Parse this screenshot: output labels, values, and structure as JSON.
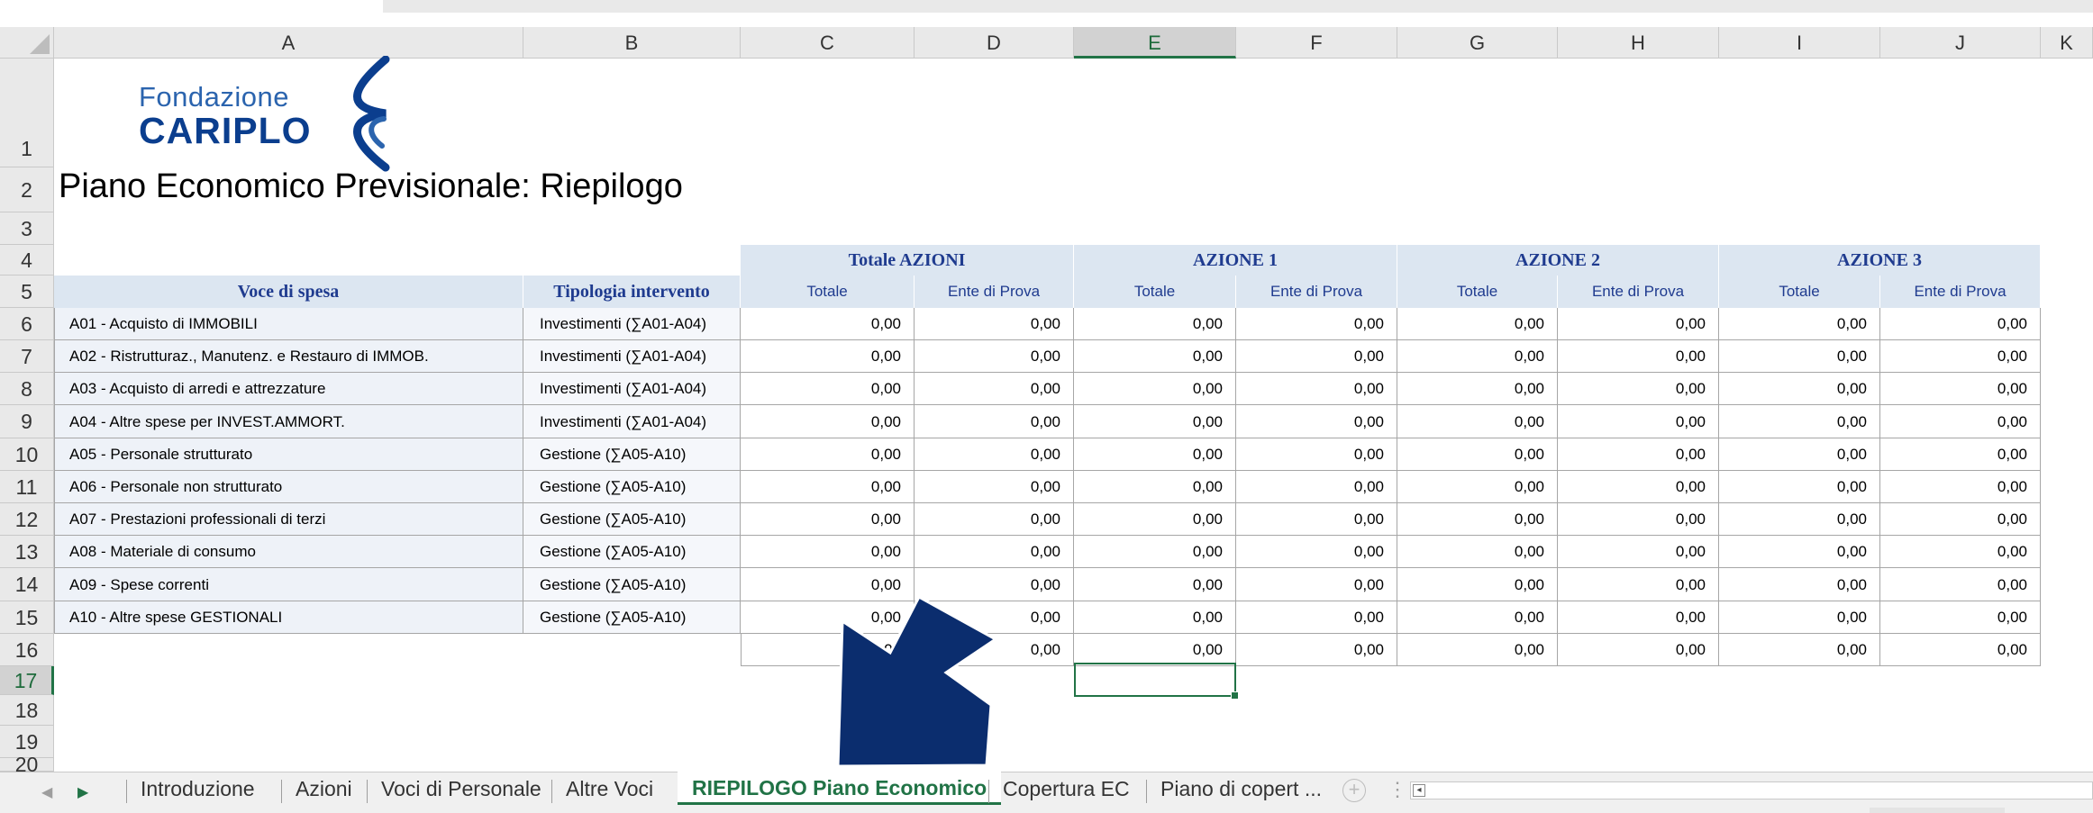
{
  "columns": [
    "A",
    "B",
    "C",
    "D",
    "E",
    "F",
    "G",
    "H",
    "I",
    "J",
    "K"
  ],
  "active_column": "E",
  "rows": [
    "1",
    "2",
    "3",
    "4",
    "5",
    "6",
    "7",
    "8",
    "9",
    "10",
    "11",
    "12",
    "13",
    "14",
    "15",
    "16",
    "17",
    "18",
    "19",
    "20"
  ],
  "active_row": "17",
  "logo": {
    "line1": "Fondazione",
    "line2": "CARIPLO",
    "color": "#0b3e8e"
  },
  "title": "Piano Economico Previsionale: Riepilogo",
  "header": {
    "groups": [
      "Totale AZIONI",
      "AZIONE 1",
      "AZIONE 2",
      "AZIONE 3"
    ],
    "voce": "Voce di spesa",
    "tipologia": "Tipologia intervento",
    "sub": [
      "Totale",
      "Ente di Prova",
      "Totale",
      "Ente di Prova",
      "Totale",
      "Ente di Prova",
      "Totale",
      "Ente di Prova"
    ]
  },
  "data_rows": [
    {
      "voce": "A01 - Acquisto di IMMOBILI",
      "tipologia": "Investimenti (∑A01-A04)",
      "values": [
        "0,00",
        "0,00",
        "0,00",
        "0,00",
        "0,00",
        "0,00",
        "0,00",
        "0,00"
      ]
    },
    {
      "voce": "A02 - Ristrutturaz., Manutenz. e Restauro di IMMOB.",
      "tipologia": "Investimenti (∑A01-A04)",
      "values": [
        "0,00",
        "0,00",
        "0,00",
        "0,00",
        "0,00",
        "0,00",
        "0,00",
        "0,00"
      ]
    },
    {
      "voce": "A03 - Acquisto di arredi e attrezzature",
      "tipologia": "Investimenti (∑A01-A04)",
      "values": [
        "0,00",
        "0,00",
        "0,00",
        "0,00",
        "0,00",
        "0,00",
        "0,00",
        "0,00"
      ]
    },
    {
      "voce": "A04 - Altre spese per INVEST.AMMORT.",
      "tipologia": "Investimenti (∑A01-A04)",
      "values": [
        "0,00",
        "0,00",
        "0,00",
        "0,00",
        "0,00",
        "0,00",
        "0,00",
        "0,00"
      ]
    },
    {
      "voce": "A05 - Personale strutturato",
      "tipologia": "Gestione (∑A05-A10)",
      "values": [
        "0,00",
        "0,00",
        "0,00",
        "0,00",
        "0,00",
        "0,00",
        "0,00",
        "0,00"
      ]
    },
    {
      "voce": "A06 - Personale non strutturato",
      "tipologia": "Gestione (∑A05-A10)",
      "values": [
        "0,00",
        "0,00",
        "0,00",
        "0,00",
        "0,00",
        "0,00",
        "0,00",
        "0,00"
      ]
    },
    {
      "voce": "A07 - Prestazioni professionali di terzi",
      "tipologia": "Gestione (∑A05-A10)",
      "values": [
        "0,00",
        "0,00",
        "0,00",
        "0,00",
        "0,00",
        "0,00",
        "0,00",
        "0,00"
      ]
    },
    {
      "voce": "A08 - Materiale di consumo",
      "tipologia": "Gestione (∑A05-A10)",
      "values": [
        "0,00",
        "0,00",
        "0,00",
        "0,00",
        "0,00",
        "0,00",
        "0,00",
        "0,00"
      ]
    },
    {
      "voce": "A09 - Spese correnti",
      "tipologia": "Gestione (∑A05-A10)",
      "values": [
        "0,00",
        "0,00",
        "0,00",
        "0,00",
        "0,00",
        "0,00",
        "0,00",
        "0,00"
      ]
    },
    {
      "voce": "A10 - Altre spese GESTIONALI",
      "tipologia": "Gestione (∑A05-A10)",
      "values": [
        "0,00",
        "0,00",
        "0,00",
        "0,00",
        "0,00",
        "0,00",
        "0,00",
        "0,00"
      ]
    }
  ],
  "totals": [
    "0,00",
    "0,00",
    "0,00",
    "0,00",
    "0,00",
    "0,00",
    "0,00",
    "0,00"
  ],
  "tabs": [
    "Introduzione",
    "Azioni",
    "Voci di Personale",
    "Altre Voci",
    "RIEPILOGO Piano Economico",
    "Copertura EC",
    "Piano di copert ..."
  ],
  "active_tab": "RIEPILOGO Piano Economico",
  "icons": {
    "prev": "triangle-left-icon",
    "next": "triangle-right-icon",
    "add": "plus-circle-icon",
    "more": "vertical-dots-icon",
    "scroll_left": "scroll-left-icon",
    "arrow": "arrow-pointer-icon"
  },
  "colors": {
    "accent": "#217346",
    "header_fill": "#dce6f1",
    "header_text": "#1f3b8f",
    "arrow": "#0b2d6e"
  }
}
